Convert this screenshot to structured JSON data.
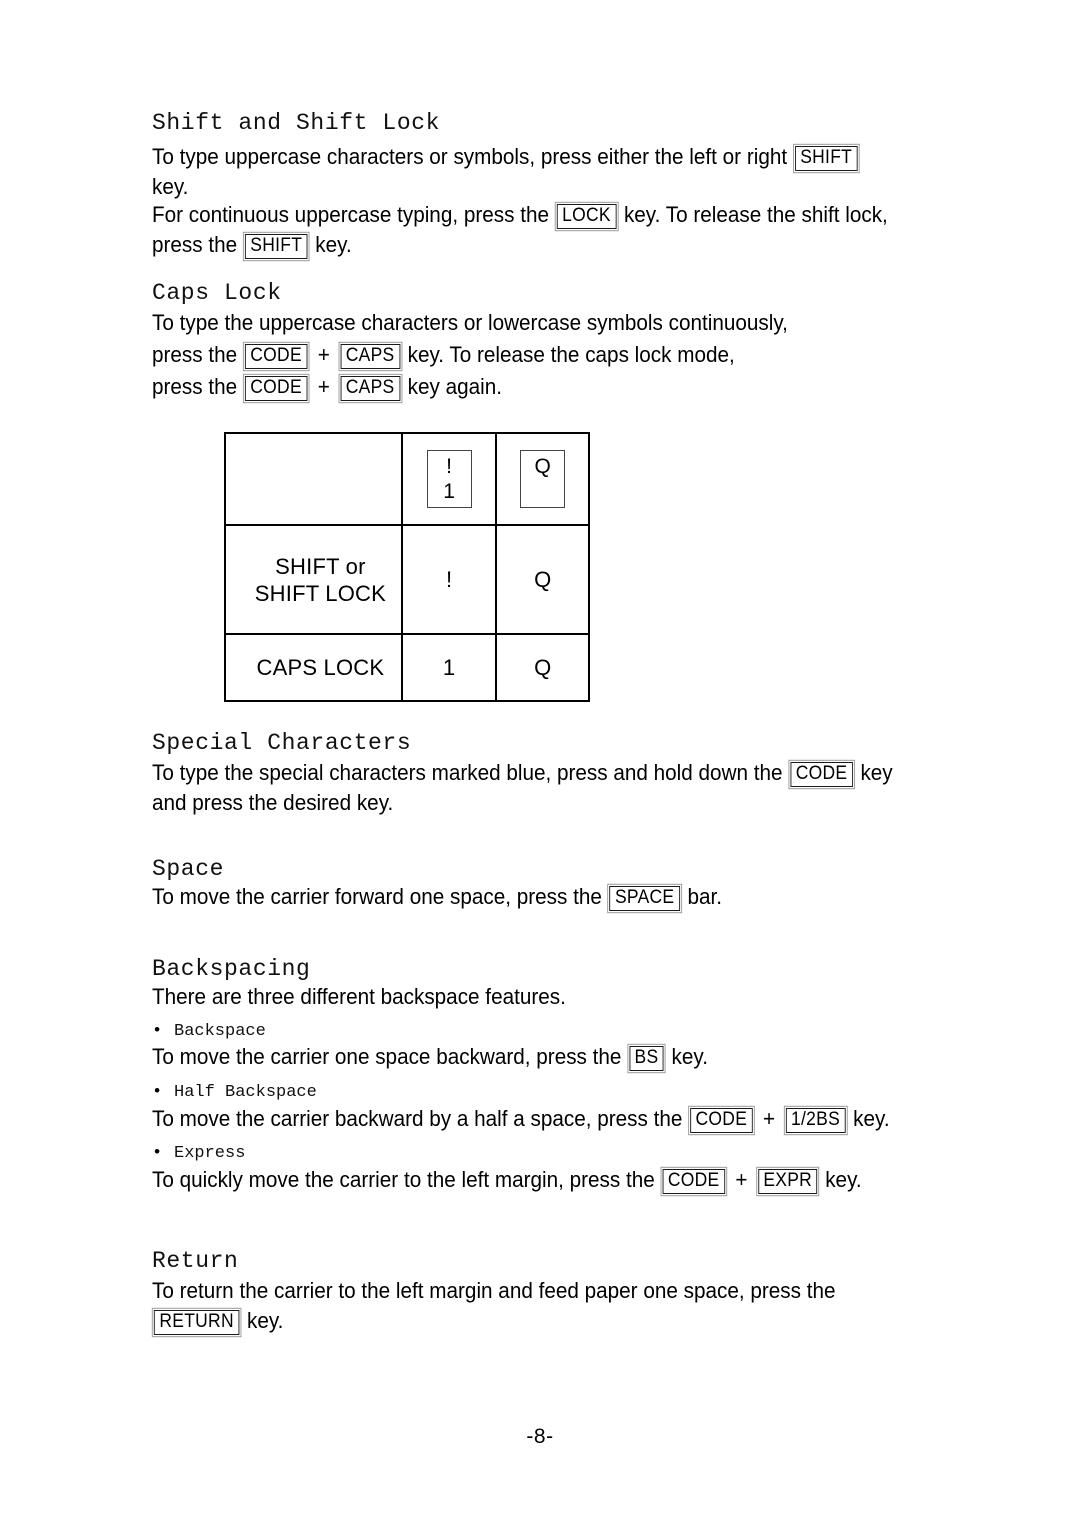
{
  "page": {
    "footer_label": "-8-"
  },
  "sections": {
    "shift": {
      "heading": "Shift and Shift Lock",
      "p1_a": "To type uppercase characters or symbols, press either the left or right",
      "p1_key": "SHIFT",
      "p1_b": "key.",
      "p2_a": "For continuous uppercase typing, press the",
      "p2_key1": "LOCK",
      "p2_b": "key. To release the shift lock,",
      "p2_c": "press the",
      "p2_key2": "SHIFT",
      "p2_d": "key."
    },
    "caps": {
      "heading": "Caps Lock",
      "line1": "To type the uppercase characters or lowercase symbols continuously,",
      "line2_a": "press the",
      "line2_key1": "CODE",
      "line2_plus": "+",
      "line2_key2": "CAPS",
      "line2_b": "key. To release the caps lock mode,",
      "line3_a": "press the",
      "line3_key1": "CODE",
      "line3_plus": "+",
      "line3_key2": "CAPS",
      "line3_b": "key again."
    },
    "special": {
      "heading": "Special Characters",
      "line1_a": "To type the special characters marked blue, press and hold down the",
      "line1_key": "CODE",
      "line1_b": "key",
      "line2": "and press the desired key."
    },
    "space": {
      "heading": "Space",
      "line1_a": "To move the carrier forward one space, press the",
      "line1_key": "SPACE",
      "line1_b": "bar."
    },
    "backspacing": {
      "heading": "Backspacing",
      "intro": "There are three different backspace features.",
      "items": [
        {
          "bullet": "•",
          "label": "Backspace",
          "text_a": "To move the carrier one space backward, press the",
          "key1": "BS",
          "text_b": "key."
        },
        {
          "bullet": "•",
          "label": "Half Backspace",
          "text_a": "To move the carrier backward by a half a space, press the",
          "key1": "CODE",
          "plus": "+",
          "key2": "1/2BS",
          "text_b": "key."
        },
        {
          "bullet": "•",
          "label": "Express",
          "text_a": "To quickly move the carrier to the left margin, press the",
          "key1": "CODE",
          "plus": "+",
          "key2": "EXPR",
          "text_b": "key."
        }
      ]
    },
    "return": {
      "heading": "Return",
      "line1": "To return the carrier to the left margin and feed paper one space, press the",
      "line2_key": "RETURN",
      "line2_b": "key."
    }
  },
  "key_table": {
    "row1": {
      "label": "",
      "cap_excl_top": "!",
      "cap_excl_bottom": "1",
      "cap_q": "Q"
    },
    "row2": {
      "label_line1": "SHIFT or",
      "label_line2": "SHIFT LOCK",
      "col2": "!",
      "col3": "Q"
    },
    "row3": {
      "label": "CAPS LOCK",
      "col2": "1",
      "col3": "Q"
    }
  }
}
